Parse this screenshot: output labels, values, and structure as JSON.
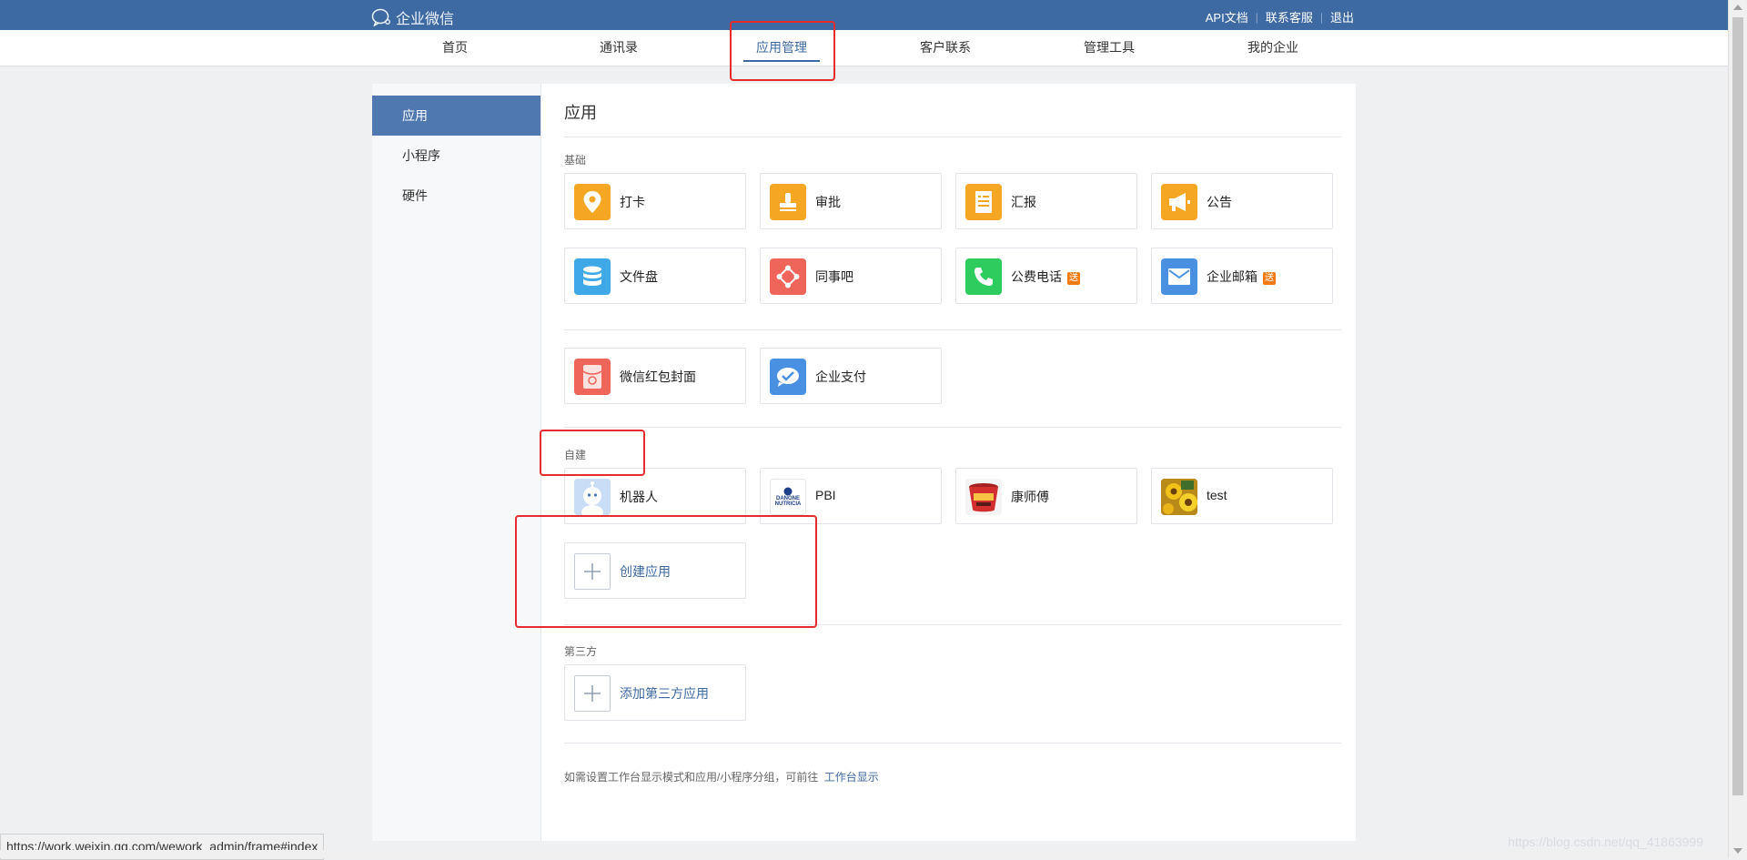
{
  "topbar": {
    "logo_text": "企业微信",
    "links": [
      "API文档",
      "联系客服",
      "退出"
    ],
    "separator": "|",
    "color": "#3e6aa3"
  },
  "nav": {
    "items": [
      "首页",
      "通讯录",
      "应用管理",
      "客户联系",
      "管理工具",
      "我的企业"
    ],
    "active_index": 2
  },
  "sidebar": {
    "items": [
      "应用",
      "小程序",
      "硬件"
    ],
    "active_index": 0
  },
  "main": {
    "title": "应用",
    "sections": {
      "basic": "基础",
      "custom": "自建",
      "third_party": "第三方"
    },
    "basic_apps": [
      {
        "label": "打卡",
        "icon": "location-pin-icon",
        "color": "#f5a623"
      },
      {
        "label": "审批",
        "icon": "stamp-icon",
        "color": "#f5a623"
      },
      {
        "label": "汇报",
        "icon": "report-icon",
        "color": "#f5a623"
      },
      {
        "label": "公告",
        "icon": "megaphone-icon",
        "color": "#f5a623"
      },
      {
        "label": "文件盘",
        "icon": "database-icon",
        "color": "#3fa9e8"
      },
      {
        "label": "同事吧",
        "icon": "network-icon",
        "color": "#f0655a"
      },
      {
        "label": "公费电话",
        "icon": "phone-icon",
        "color": "#2ecc5e",
        "badge": "送"
      },
      {
        "label": "企业邮箱",
        "icon": "mail-icon",
        "color": "#4a90e2",
        "badge": "送"
      }
    ],
    "extra_apps": [
      {
        "label": "微信红包封面",
        "icon": "red-packet-icon",
        "color": "#f0655a"
      },
      {
        "label": "企业支付",
        "icon": "payment-icon",
        "color": "#4a90e2"
      }
    ],
    "custom_apps": [
      {
        "label": "机器人",
        "icon": "robot-icon"
      },
      {
        "label": "PBI",
        "icon": "danone-logo-icon",
        "logo_text": "DANONE NUTRICIA"
      },
      {
        "label": "康师傅",
        "icon": "noodle-bowl-icon"
      },
      {
        "label": "test",
        "icon": "flower-photo-icon"
      }
    ],
    "create_app_label": "创建应用",
    "add_third_party_label": "添加第三方应用",
    "footer_text": "如需设置工作台显示模式和应用/小程序分组，可前往",
    "footer_link": "工作台显示"
  },
  "browser": {
    "status_url": "https://work.weixin.qq.com/wework_admin/frame#index",
    "watermark": "https://blog.csdn.net/qq_41863999"
  },
  "annotation_color": "#e52b2b"
}
